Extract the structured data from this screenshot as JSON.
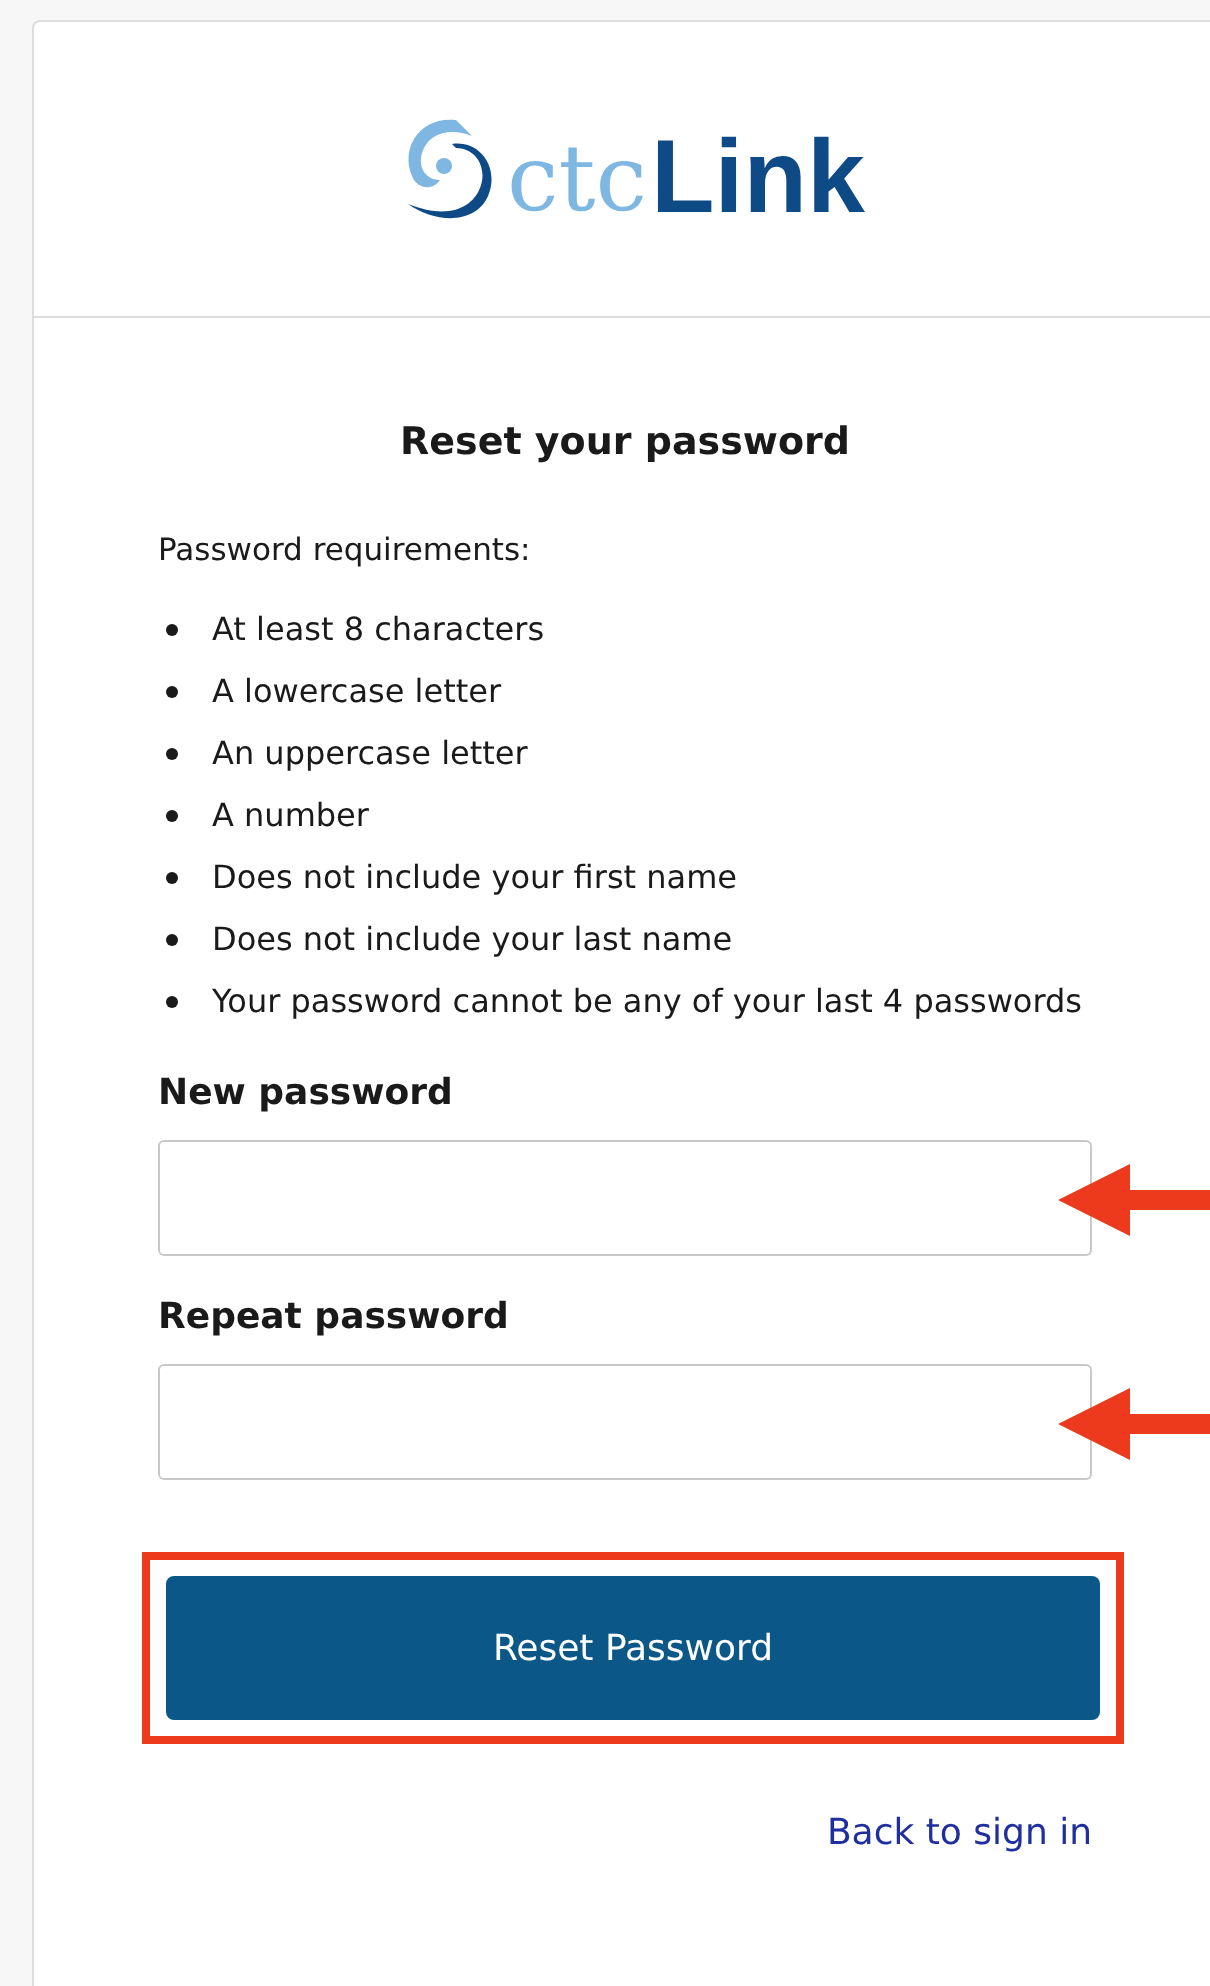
{
  "logo": {
    "prefix": "ctc",
    "name": "Link"
  },
  "title": "Reset your password",
  "requirements_heading": "Password requirements:",
  "requirements": [
    "At least 8 characters",
    "A lowercase letter",
    "An uppercase letter",
    "A number",
    "Does not include your first name",
    "Does not include your last name",
    "Your password cannot be any of your last 4 passwords"
  ],
  "fields": [
    {
      "label": "New password",
      "arrow": true
    },
    {
      "label": "Repeat password",
      "arrow": true
    }
  ],
  "submit": {
    "label": "Reset Password",
    "highlighted": true
  },
  "back_link": "Back to sign in"
}
